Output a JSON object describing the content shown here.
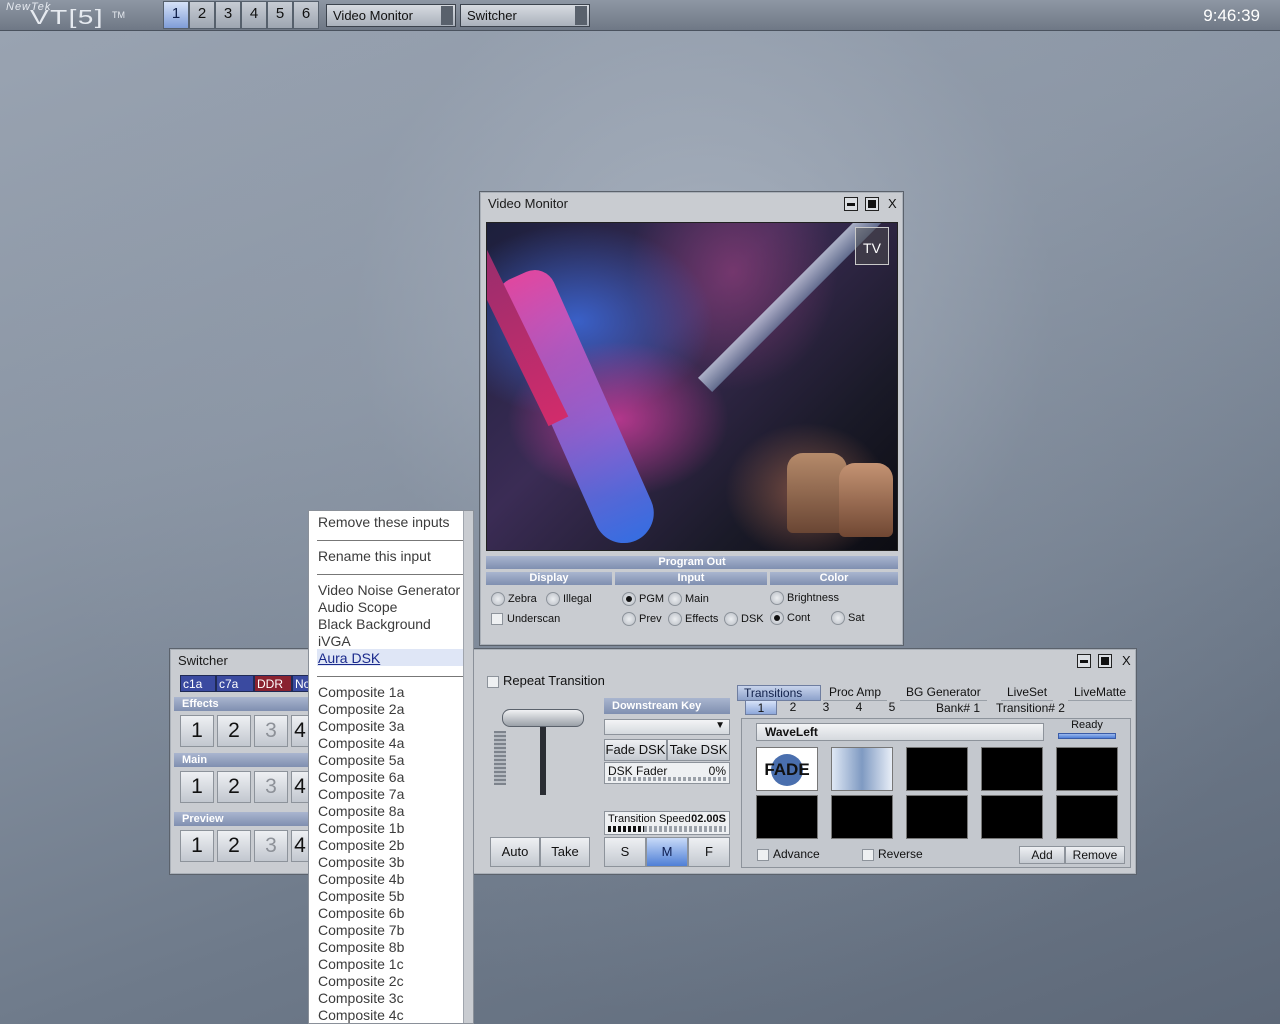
{
  "taskbar": {
    "logo_brand": "NewTek",
    "logo_model": "VT[5]",
    "logo_tm": "TM",
    "desktops": [
      "1",
      "2",
      "3",
      "4",
      "5",
      "6"
    ],
    "active_desktop": "1",
    "tasks": [
      "Video Monitor",
      "Switcher"
    ],
    "clock": "9:46:39"
  },
  "video_monitor": {
    "title": "Video Monitor",
    "close": "X",
    "tv_logo": "TV",
    "caption": "Program Out",
    "sections": [
      "Display",
      "Input",
      "Color"
    ],
    "display_options": [
      "Zebra",
      "Illegal",
      "Underscan"
    ],
    "input_options": [
      "PGM",
      "Main",
      "Prev",
      "Effects",
      "DSK"
    ],
    "input_selected": "PGM",
    "color_options": [
      "Brightness",
      "Cont",
      "Sat"
    ],
    "color_selected": "Cont"
  },
  "switcher": {
    "title": "Switcher",
    "close": "X",
    "chips": [
      "c1a",
      "c7a",
      "DDR",
      "No"
    ],
    "rows": [
      "Effects",
      "Main",
      "Preview"
    ],
    "row_buttons": [
      "1",
      "2",
      "3",
      "4"
    ],
    "repeat_transition": "Repeat Transition",
    "auto": "Auto",
    "take": "Take",
    "dsk": {
      "header": "Downstream Key",
      "fade": "Fade DSK",
      "take": "Take DSK",
      "fader_label": "DSK Fader",
      "fader_value": "0%",
      "speed_label": "Transition Speed",
      "speed_value": "02.00S"
    },
    "speed_buttons": [
      "S",
      "M",
      "F"
    ],
    "speed_selected": "M",
    "tabs": [
      "Transitions",
      "Proc Amp",
      "BG Generator",
      "LiveSet",
      "LiveMatte"
    ],
    "active_tab": "Transitions",
    "banks": [
      "1",
      "2",
      "3",
      "4",
      "5"
    ],
    "bank_label": "Bank#  1",
    "transition_label": "Transition#  2",
    "transition_name": "WaveLeft",
    "status": "Ready",
    "fade_thumb": "FADE",
    "advance": "Advance",
    "reverse": "Reverse",
    "add": "Add",
    "remove": "Remove"
  },
  "context_menu": {
    "top_items": [
      "Remove these inputs",
      "Rename this input"
    ],
    "tools": [
      "Video Noise Generator",
      "Audio Scope",
      "Black Background",
      "iVGA",
      "Aura DSK"
    ],
    "highlighted": "Aura DSK",
    "composites": [
      "Composite 1a",
      "Composite 2a",
      "Composite 3a",
      "Composite 4a",
      "Composite 5a",
      "Composite 6a",
      "Composite 7a",
      "Composite 8a",
      "Composite 1b",
      "Composite 2b",
      "Composite 3b",
      "Composite 4b",
      "Composite 5b",
      "Composite 6b",
      "Composite 7b",
      "Composite 8b",
      "Composite 1c",
      "Composite 2c",
      "Composite 3c",
      "Composite 4c"
    ]
  }
}
